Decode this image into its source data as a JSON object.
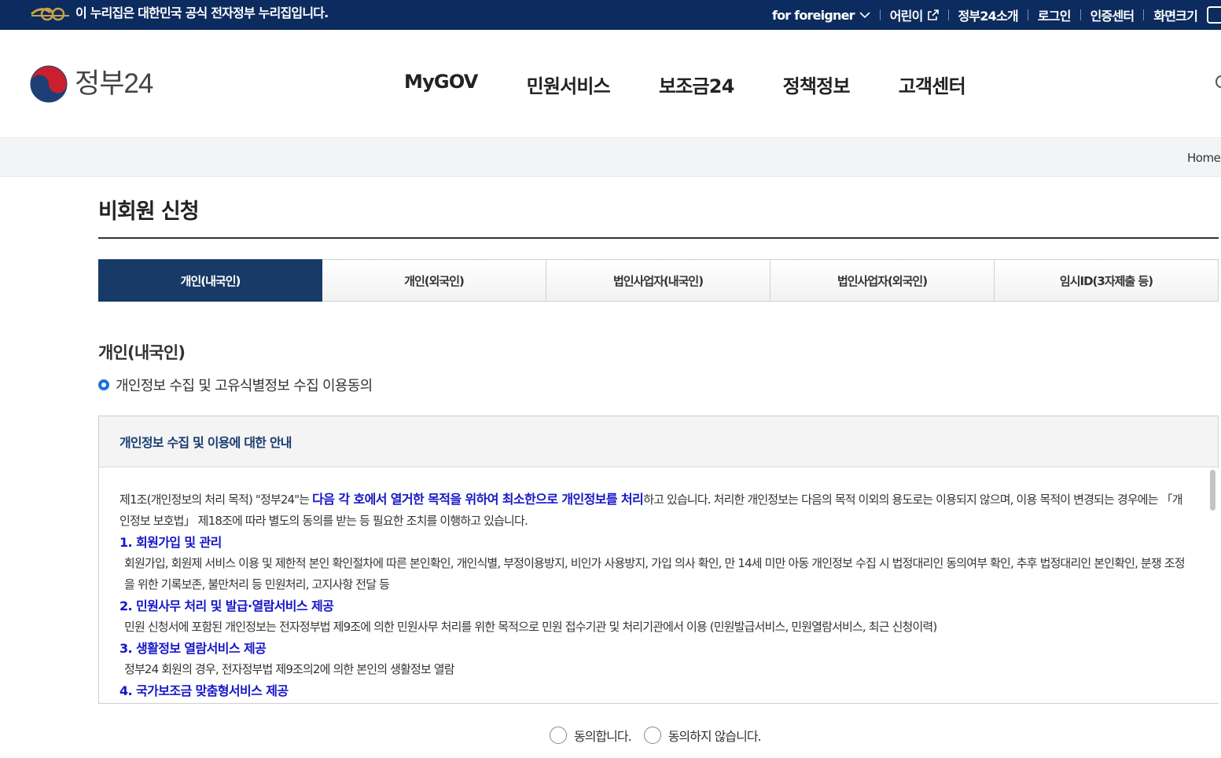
{
  "gov_banner": {
    "emblem_icon": "egov-emblem-icon",
    "notice": "이 누리집은 대한민국 공식 전자정부 누리집입니다."
  },
  "utility_nav": {
    "foreigner": "for foreigner",
    "kids": "어린이",
    "about": "정부24소개",
    "login": "로그인",
    "cert": "인증센터",
    "zoom": "화면크기"
  },
  "header": {
    "logo_text": "정부24",
    "logo_icon": "taegeuk-logo-icon",
    "nav": [
      "MyGOV",
      "민원서비스",
      "보조금24",
      "정책정보",
      "고객센터"
    ]
  },
  "breadcrumb": {
    "home": "Home"
  },
  "page": {
    "title": "비회원 신청"
  },
  "tabs": [
    {
      "label": "개인(내국인)",
      "active": true
    },
    {
      "label": "개인(외국인)",
      "active": false
    },
    {
      "label": "법인사업자(내국인)",
      "active": false
    },
    {
      "label": "법인사업자(외국인)",
      "active": false
    },
    {
      "label": "임시ID(3자제출 등)",
      "active": false
    }
  ],
  "section": {
    "title": "개인(내국인)",
    "consent_heading": "개인정보 수집 및 고유식별정보 수집 이용동의"
  },
  "terms": {
    "head": "개인정보 수집 및 이용에 대한 안내",
    "intro_pre": "제1조(개인정보의 처리 목적) \"정부24\"는 ",
    "intro_hl": "다음 각 호에서 열거한 목적을 위하여 최소한으로 개인정보를 처리",
    "intro_post": "하고 있습니다. 처리한 개인정보는 다음의 목적 이외의 용도로는 이용되지 않으며, 이용 목적이 변경되는 경우에는 「개인정보 보호법」 제18조에 따라 별도의 동의를 받는 등 필요한 조치를 이행하고 있습니다.",
    "items": [
      {
        "head": "1. 회원가입 및 관리",
        "desc": "회원가입, 회원제 서비스 이용 및 제한적 본인 확인절차에 따른 본인확인, 개인식별, 부정이용방지, 비인가 사용방지, 가입 의사 확인, 만 14세 미만 아동 개인정보 수집 시 법정대리인 동의여부 확인, 추후 법정대리인 본인확인, 분쟁 조정을 위한 기록보존, 불만처리 등 민원처리, 고지사항 전달 등"
      },
      {
        "head": "2. 민원사무 처리 및 발급·열람서비스 제공",
        "desc": "민원 신청서에 포함된 개인정보는 전자정부법 제9조에 의한 민원사무 처리를 위한 목적으로 민원 접수기관 및 처리기관에서 이용 (민원발급서비스, 민원열람서비스, 최근 신청이력)"
      },
      {
        "head": "3. 생활정보 열람서비스 제공",
        "desc": "정부24 회원의 경우, 전자정부법 제9조의2에 의한 본인의 생활정보 열람"
      },
      {
        "head": "4. 국가보조금 맞춤형서비스 제공",
        "desc": ""
      }
    ]
  },
  "agree": {
    "yes": "동의합니다.",
    "no": "동의하지 않습니다."
  },
  "colors": {
    "gov_bar": "#0c2b5e",
    "active_tab": "#173a66",
    "highlight": "#1515c8",
    "bullet": "#1a73d9"
  }
}
